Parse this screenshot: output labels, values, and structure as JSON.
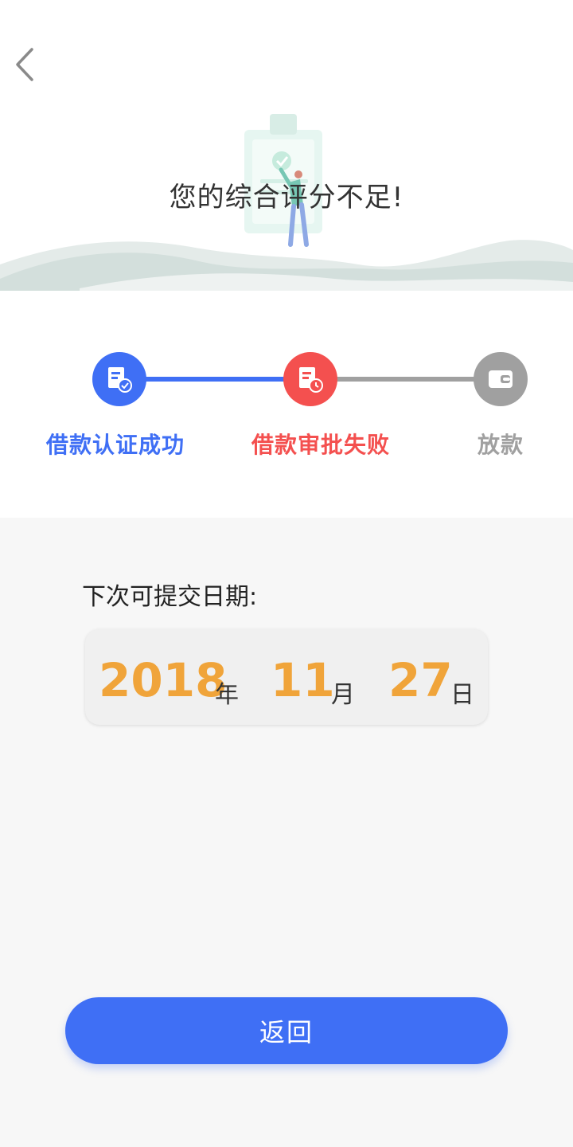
{
  "header": {
    "back_icon": "chevron-left-icon",
    "illustration": "clipboard-person-illustration",
    "title": "您的综合评分不足!"
  },
  "progress": {
    "steps": [
      {
        "label": "借款认证成功",
        "icon": "document-check-icon",
        "color": "#3f6ff5",
        "status": "done"
      },
      {
        "label": "借款审批失败",
        "icon": "document-clock-icon",
        "color": "#f4504f",
        "status": "failed"
      },
      {
        "label": "放款",
        "icon": "wallet-icon",
        "color": "#a0a0a0",
        "status": "pending"
      }
    ]
  },
  "next_submit": {
    "label": "下次可提交日期:",
    "year": "2018",
    "year_unit": "年",
    "month": "11",
    "month_unit": "月",
    "day": "27",
    "day_unit": "日"
  },
  "actions": {
    "return_label": "返回"
  },
  "colors": {
    "primary": "#3f6ff5",
    "error": "#f4504f",
    "inactive": "#a0a0a0",
    "date_number": "#f0a43a"
  }
}
